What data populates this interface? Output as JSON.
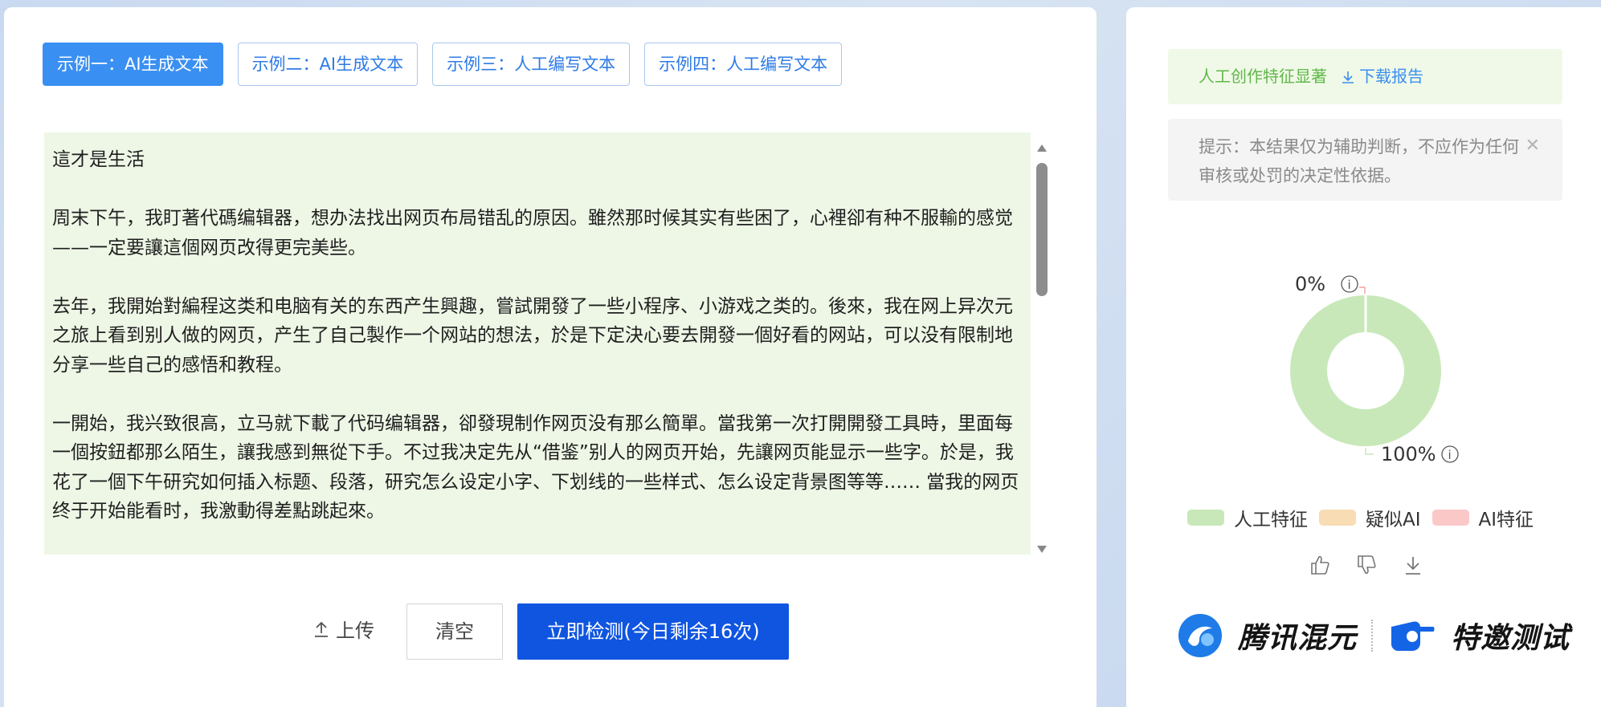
{
  "tabs": [
    {
      "label": "示例一：AI生成文本",
      "active": true
    },
    {
      "label": "示例二：AI生成文本",
      "active": false
    },
    {
      "label": "示例三：人工编写文本",
      "active": false
    },
    {
      "label": "示例四：人工编写文本",
      "active": false
    }
  ],
  "editor": {
    "paragraphs": [
      "這才是生活",
      "周末下午，我盯著代碼编辑器，想办法找出网页布局错乱的原因。雖然那时候其实有些困了，心裡卻有种不服輸的感觉——一定要讓這個网页改得更完美些。",
      "去年，我開始對編程这类和电脑有关的东西产生興趣，嘗試開發了一些小程序、小游戏之类的。後來，我在网上异次元之旅上看到别人做的网页，产生了自己製作一个网站的想法，於是下定決心要去開發一個好看的网站，可以没有限制地分享一些自己的感悟和教程。",
      "一開始，我兴致很高，立马就下載了代码编辑器，卻發現制作网页没有那么簡單。當我第一次打開開發工具時，里面每一個按鈕都那么陌生，讓我感到無從下手。不过我决定先从“借鉴”别人的网页开始，先讓网页能显示一些字。於是，我花了一個下午研究如何插入标题、段落，研究怎么设定小字、下划线的一些样式、怎么设定背景图等等…… 當我的网页终于开始能看时，我激動得差點跳起來。"
    ]
  },
  "actions": {
    "upload_label": "上传",
    "clear_label": "清空",
    "detect_label": "立即检测(今日剩余16次)"
  },
  "result": {
    "verdict": "人工创作特征显著",
    "download_label": "下载报告",
    "hint": "提示：本结果仅为辅助判断，不应作为任何审核或处罚的决定性依据。"
  },
  "chart_data": {
    "type": "pie",
    "labels": [
      "人工特征",
      "疑似AI",
      "AI特征"
    ],
    "values": [
      100,
      0,
      0
    ],
    "colors": [
      "#c8e8b9",
      "#f7dcb4",
      "#fbc8c8"
    ],
    "slice_labels": [
      "100%",
      "0%"
    ],
    "donut": true,
    "legend_position": "bottom"
  },
  "brand": {
    "left": "腾讯混元",
    "right": "特邀测试"
  },
  "colors": {
    "primary": "#0f55e0",
    "accent": "#3a8ff2",
    "success_text": "#5fb84a"
  }
}
